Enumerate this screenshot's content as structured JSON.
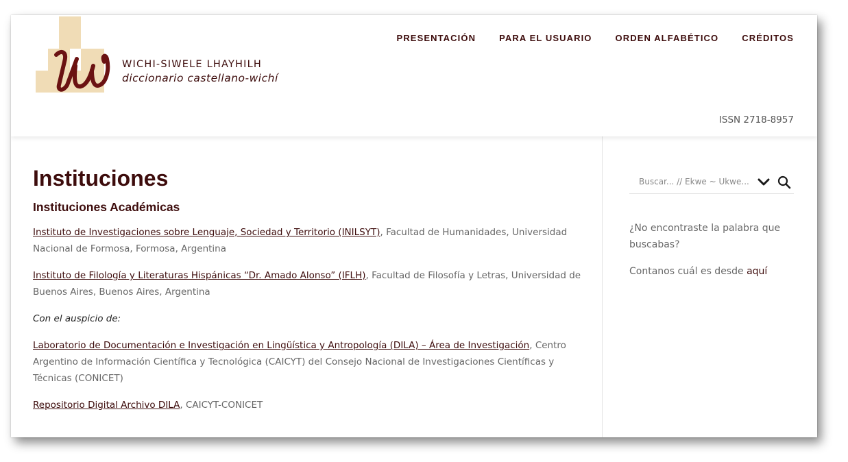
{
  "header": {
    "logo_title": "WICHI-SIWELE LHAYHILH",
    "logo_subtitle": "diccionario castellano-wichí",
    "issn": "ISSN 2718-8957"
  },
  "nav": [
    {
      "label": "PRESENTACIÓN"
    },
    {
      "label": "PARA EL USUARIO"
    },
    {
      "label": "ORDEN ALFABÉTICO"
    },
    {
      "label": "CRÉDITOS"
    }
  ],
  "main": {
    "title": "Instituciones",
    "section_title": "Instituciones Académicas",
    "entries": [
      {
        "link": "Instituto de Investigaciones sobre Lenguaje, Sociedad y Territorio (INILSYT)",
        "text": ", Facultad de Humanidades, Universidad Nacional de Formosa, Formosa, Argentina"
      },
      {
        "link": "Instituto de Filología y Literaturas Hispánicas “Dr. Amado Alonso” (IFLH)",
        "text": ", Facultad de Filosofía y Letras, Universidad de Buenos Aires, Buenos Aires, Argentina"
      },
      {
        "link": "Laboratorio de Documentación e Investigación en Lingüística y Antropología (DILA) – Área de Investigación",
        "text": ", Centro Argentino de Información Científica y Tecnológica (CAICYT) del Consejo Nacional de Investigaciones Científicas y Técnicas (CONICET)"
      },
      {
        "link": "Repositorio Digital Archivo DILA",
        "text": ", CAICYT-CONICET"
      }
    ],
    "auspicio_label": "Con el auspicio de:"
  },
  "sidebar": {
    "search_placeholder": "Buscar... // Ekwe ~ Ukwe...",
    "question": "¿No encontraste la palabra que buscabas?",
    "contact_text": "Contanos cuál es desde ",
    "contact_link": "aquí"
  },
  "colors": {
    "brand": "#3d0c0c",
    "logo_blocks": "#f0dcb6",
    "text_gray": "#666666"
  },
  "icons": [
    "chevron-down-icon",
    "search-icon"
  ]
}
